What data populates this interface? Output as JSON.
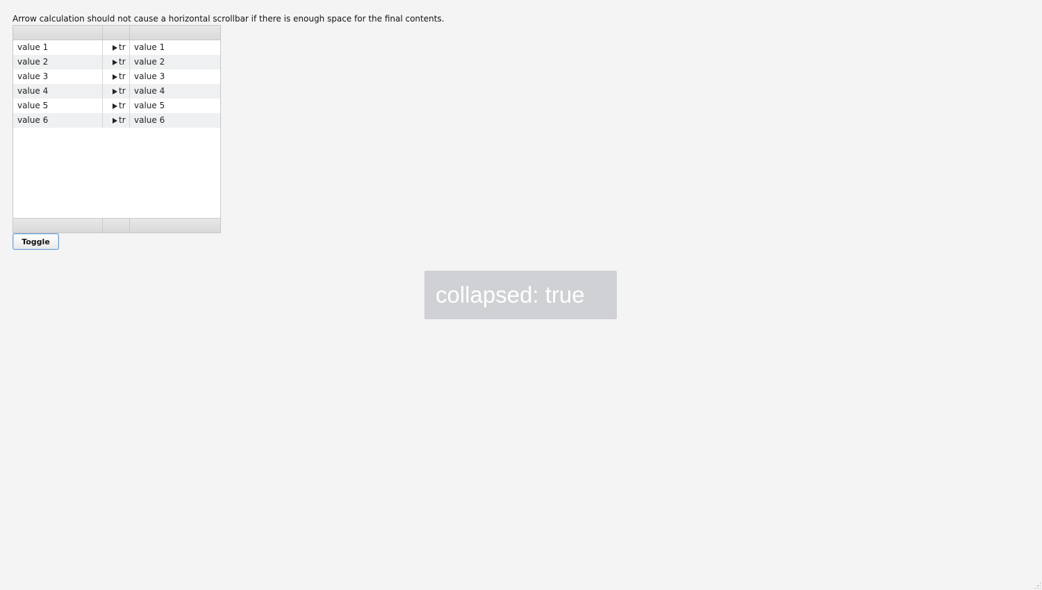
{
  "description": "Arrow calculation should not cause a horizontal scrollbar if there is enough space for the final contents.",
  "grid": {
    "rows": [
      {
        "col1": "value 1",
        "col2": "tr",
        "col3": "value 1"
      },
      {
        "col1": "value 2",
        "col2": "tr",
        "col3": "value 2"
      },
      {
        "col1": "value 3",
        "col2": "tr",
        "col3": "value 3"
      },
      {
        "col1": "value 4",
        "col2": "tr",
        "col3": "value 4"
      },
      {
        "col1": "value 5",
        "col2": "tr",
        "col3": "value 5"
      },
      {
        "col1": "value 6",
        "col2": "tr",
        "col3": "value 6"
      }
    ]
  },
  "toggle": {
    "label": "Toggle"
  },
  "status": {
    "text": "collapsed: true"
  },
  "icons": {
    "row_arrow": "expand-arrow-icon",
    "resize": "resize-grip-icon"
  }
}
